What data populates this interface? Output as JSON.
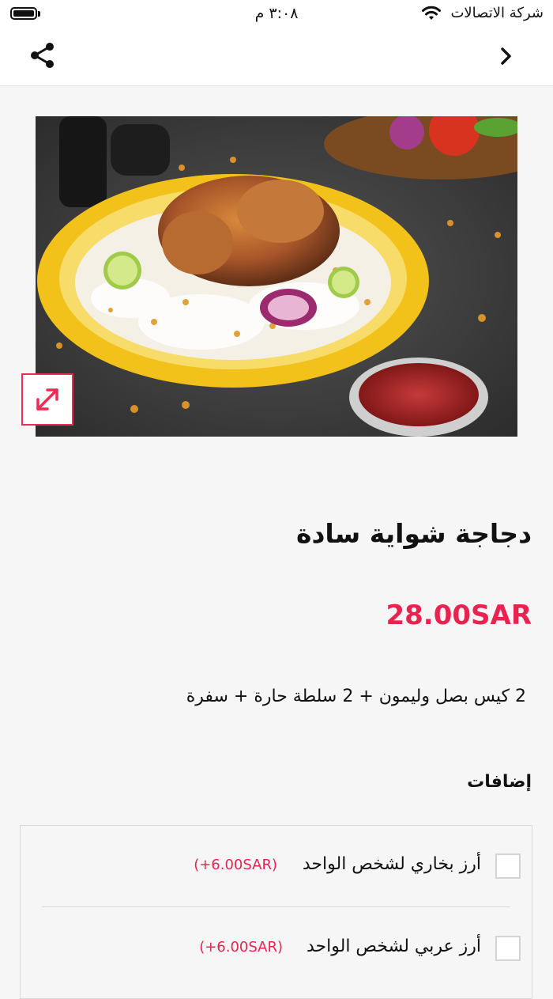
{
  "status_bar": {
    "carrier": "شركة الاتصالات",
    "time": "٣:٠٨ م"
  },
  "nav": {
    "share_icon": "share-icon",
    "back_icon": "chevron-right-icon"
  },
  "product": {
    "title": "دجاجة شواية سادة",
    "price": "28.00SAR",
    "description": "2 كيس بصل وليمون + 2 سلطة حارة + سفرة"
  },
  "addons": {
    "title": "إضافات",
    "options": [
      {
        "label": "أرز بخاري لشخص الواحد",
        "price": "(+6.00SAR)",
        "checked": false
      },
      {
        "label": "أرز عربي لشخص الواحد",
        "price": "(+6.00SAR)",
        "checked": false
      }
    ]
  },
  "colors": {
    "accent": "#e8234f",
    "plate": "#f2c21a"
  }
}
